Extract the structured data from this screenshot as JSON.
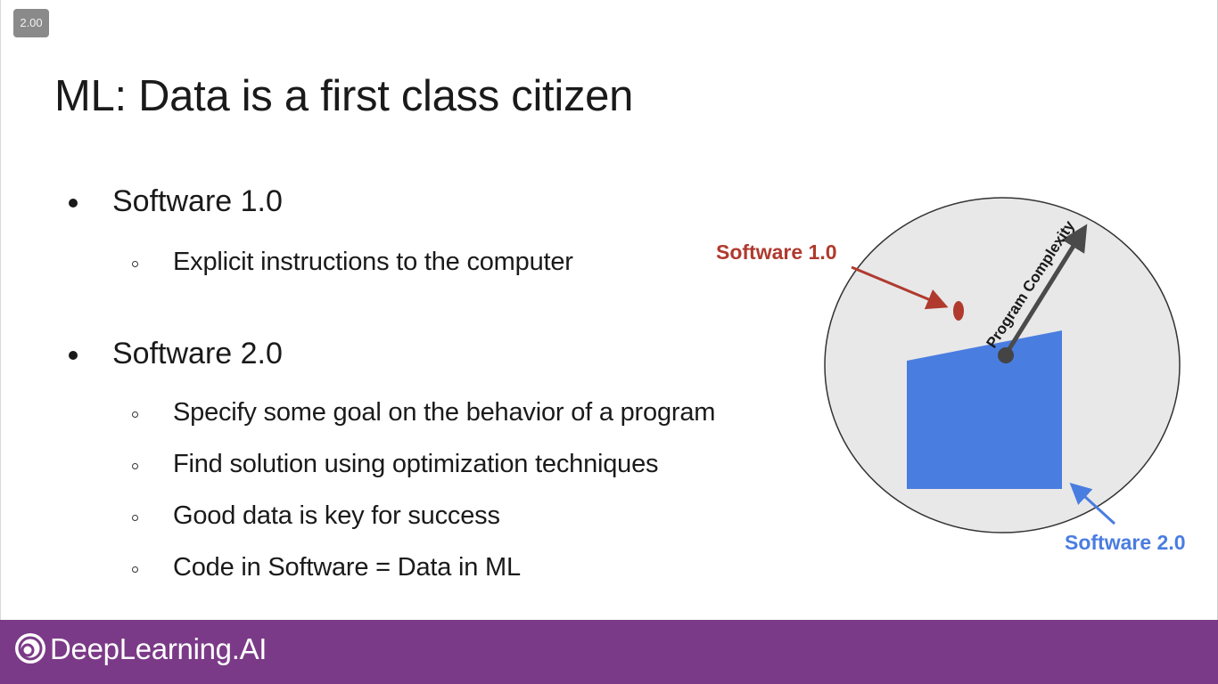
{
  "player": {
    "playback_speed": "2.00"
  },
  "slide": {
    "title": "ML: Data is a first class citizen",
    "bullets": [
      {
        "label": "Software 1.0",
        "subitems": [
          "Explicit instructions to the computer"
        ]
      },
      {
        "label": "Software 2.0",
        "subitems": [
          "Specify some goal on the behavior of a program",
          "Find solution using optimization techniques",
          "Good data is key for success",
          "Code in Software = Data in ML"
        ]
      }
    ]
  },
  "diagram": {
    "software1_label": "Software 1.0",
    "software2_label": "Software 2.0",
    "axis_label": "Program Complexity",
    "colors": {
      "software1": "#b03a2e",
      "software2": "#4a7de0",
      "circle_fill": "#e8e8e8",
      "axis": "#4a4a4a"
    }
  },
  "footer": {
    "brand": "DeepLearning.AI",
    "background": "#7b3a87"
  }
}
